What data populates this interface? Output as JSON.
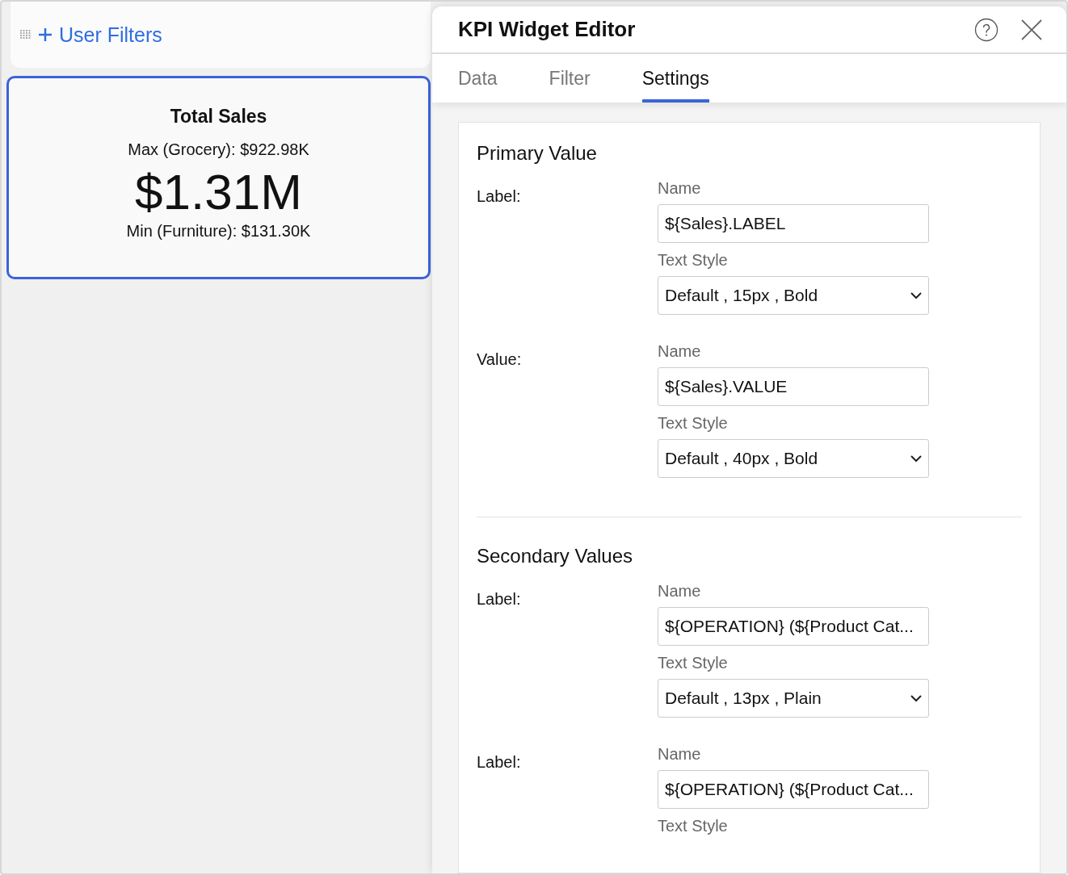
{
  "dashboard": {
    "user_filters": {
      "label": "User Filters"
    },
    "kpi_card": {
      "selected": true,
      "title": "Total Sales",
      "max_line": "Max (Grocery): $922.98K",
      "value": "$1.31M",
      "min_line": "Min (Furniture): $131.30K"
    }
  },
  "editor": {
    "title": "KPI Widget Editor",
    "tabs": [
      {
        "label": "Data",
        "selected": false
      },
      {
        "label": "Filter",
        "selected": false
      },
      {
        "label": "Settings",
        "selected": true
      }
    ],
    "sections": [
      {
        "title": "Primary Value",
        "fields": [
          {
            "label": "Label:",
            "name_caption": "Name",
            "name_value": "${Sales}.LABEL",
            "style_caption": "Text Style",
            "style_value": "Default , 15px , Bold"
          },
          {
            "label": "Value:",
            "name_caption": "Name",
            "name_value": "${Sales}.VALUE",
            "style_caption": "Text Style",
            "style_value": "Default , 40px , Bold"
          }
        ]
      },
      {
        "title": "Secondary Values",
        "fields": [
          {
            "label": "Label:",
            "name_caption": "Name",
            "name_value": "${OPERATION} (${Product Cat...",
            "style_caption": "Text Style",
            "style_value": "Default , 13px , Plain"
          },
          {
            "label": "Label:",
            "name_caption": "Name",
            "name_value": "${OPERATION} (${Product Cat...",
            "style_caption": "Text Style"
          }
        ]
      }
    ]
  }
}
